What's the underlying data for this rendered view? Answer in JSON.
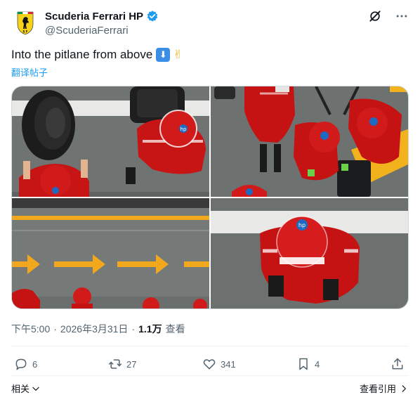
{
  "author": {
    "display_name": "Scuderia Ferrari HP",
    "handle": "@ScuderiaFerrari",
    "verified": true,
    "avatar_icon": "prancing-horse-shield-icon"
  },
  "header_icons": [
    "grok-icon",
    "more-icon"
  ],
  "tweet": {
    "text": "Into the pitlane from above",
    "emoji_1": "⬇",
    "emoji_2": "✌",
    "translate_label": "翻译帖子"
  },
  "media": [
    {
      "description_icon": "pit-crew-tyre-photo"
    },
    {
      "description_icon": "pit-crew-group-photo"
    },
    {
      "description_icon": "pitlane-arrows-photo"
    },
    {
      "description_icon": "mechanic-helmet-photo"
    }
  ],
  "meta": {
    "time": "下午5:00",
    "separator": "·",
    "date": "2026年3月31日",
    "separator2": "·",
    "views_count": "1.1万",
    "views_label": "查看"
  },
  "actions": {
    "reply_count": "6",
    "retweet_count": "27",
    "like_count": "341",
    "bookmark_count": "4"
  },
  "footer": {
    "related_label": "相关",
    "quotes_label": "查看引用"
  },
  "colors": {
    "accent": "#1d9bf0",
    "ferrari_red": "#d40000",
    "asphalt": "#707574",
    "lane_yellow": "#f2a81d"
  }
}
